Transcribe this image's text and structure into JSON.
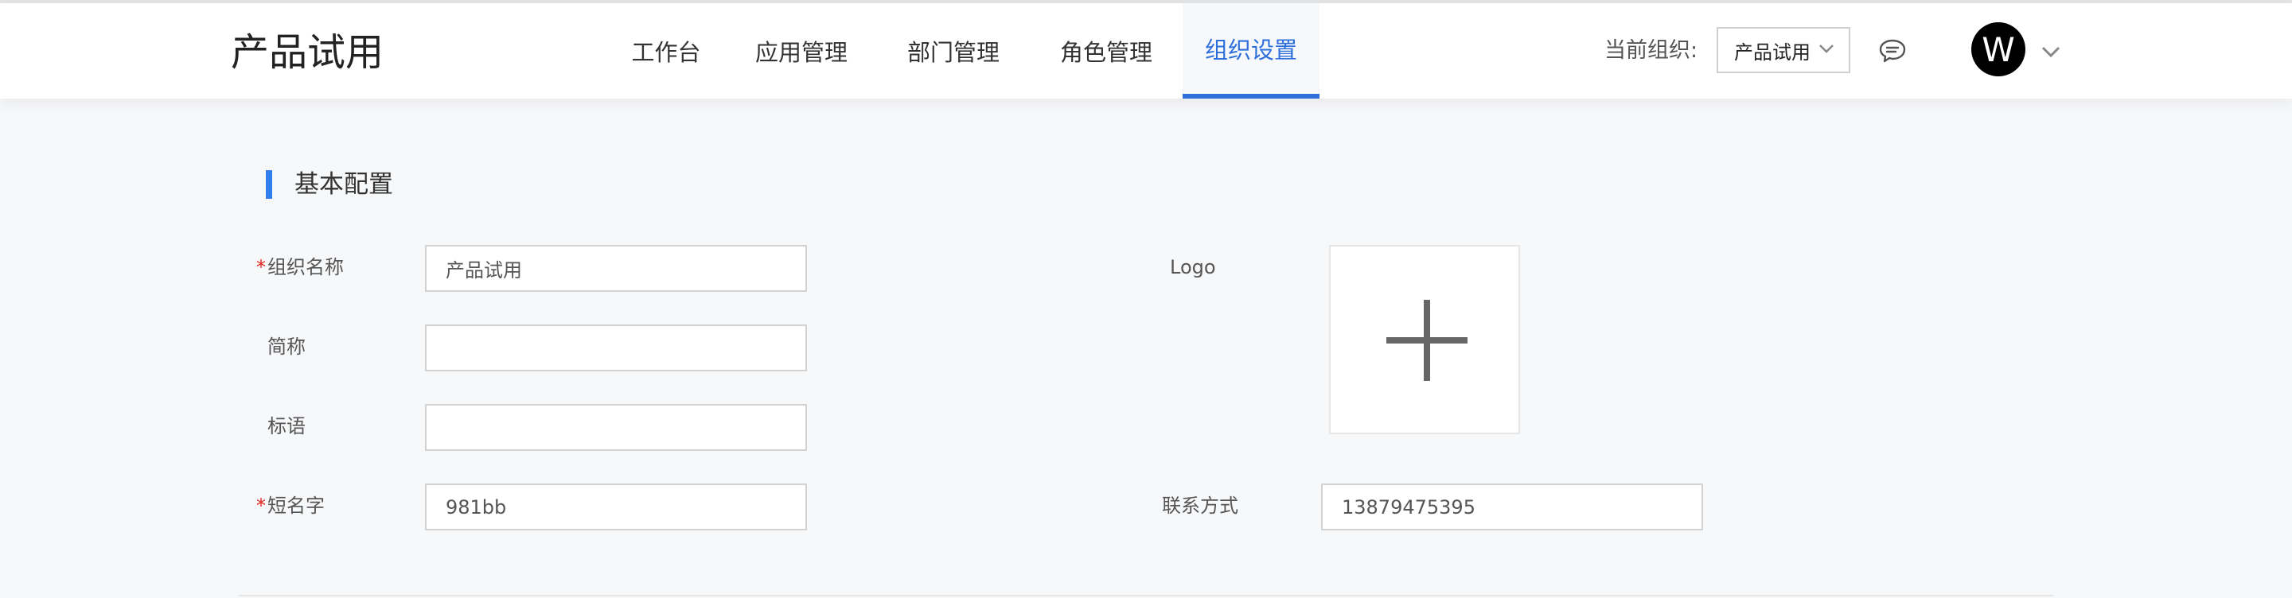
{
  "header": {
    "app_title": "产品试用",
    "nav": [
      {
        "label": "工作台",
        "active": false
      },
      {
        "label": "应用管理",
        "active": false
      },
      {
        "label": "部门管理",
        "active": false
      },
      {
        "label": "角色管理",
        "active": false
      },
      {
        "label": "组织设置",
        "active": true
      }
    ],
    "org_label": "当前组织:",
    "org_select_value": "产品试用",
    "chat_icon": "chat-bubble-icon",
    "avatar_letter": "W",
    "avatar_chevron_icon": "chevron-down-icon"
  },
  "section": {
    "title": "基本配置"
  },
  "form": {
    "org_name": {
      "label": "组织名称",
      "required": true,
      "value": "产品试用"
    },
    "short_name": {
      "label": "简称",
      "required": false,
      "value": ""
    },
    "slogan": {
      "label": "标语",
      "required": false,
      "value": ""
    },
    "short_code": {
      "label": "短名字",
      "required": true,
      "value": "981bb"
    },
    "logo": {
      "label": "Logo",
      "upload_icon": "plus-icon"
    },
    "contact": {
      "label": "联系方式",
      "value": "13879475395"
    }
  },
  "colors": {
    "accent": "#2f6fdc",
    "section_bar": "#2f80ed",
    "required": "#e2231a"
  }
}
